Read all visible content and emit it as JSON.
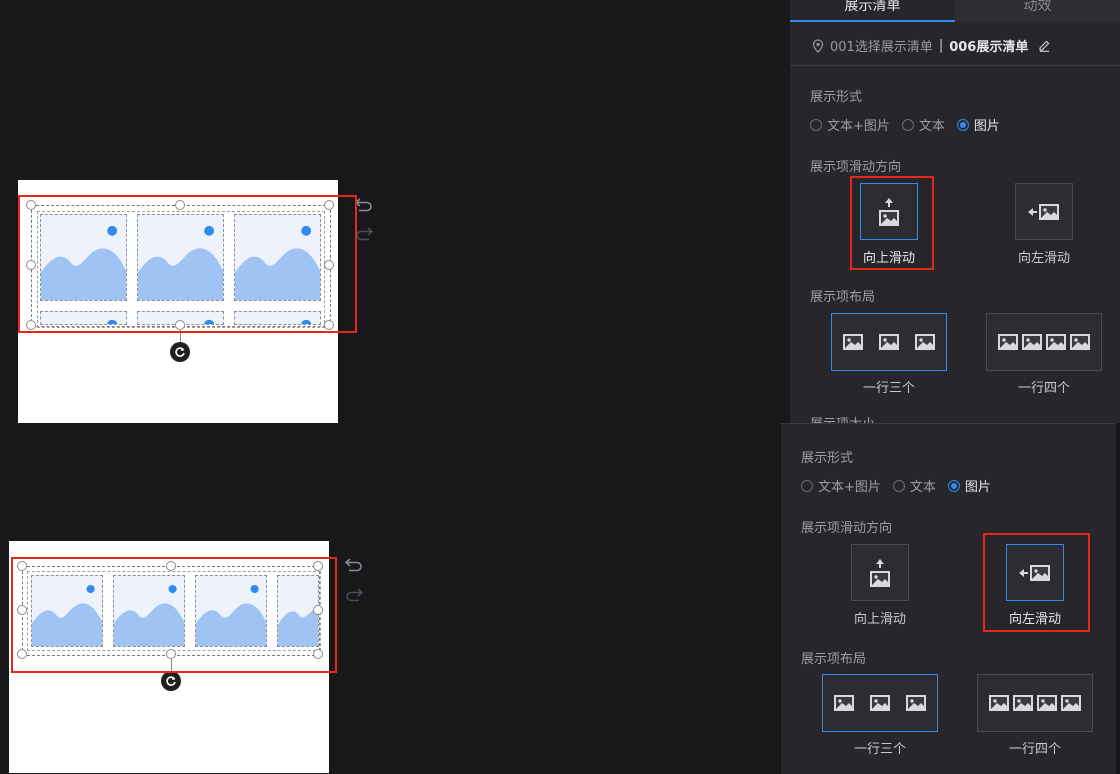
{
  "colors": {
    "background": "#18181b",
    "panel": "#26262b",
    "accent": "#2e8cf0",
    "highlight_red": "#e6281c",
    "tile_fill": "#eef3fb",
    "mountain": "#9fc3f3",
    "sun": "#2e8cf0"
  },
  "top_panel": {
    "tabs": [
      {
        "label": "展示清单",
        "active": true
      },
      {
        "label": "动效",
        "active": false
      }
    ],
    "breadcrumb": {
      "step": "001选择展示清单",
      "separator": "|",
      "current": "006展示清单",
      "edit_icon": "pencil-icon",
      "location_icon": "location-pin-icon"
    },
    "display_form": {
      "title": "展示形式",
      "options": [
        "文本+图片",
        "文本",
        "图片"
      ],
      "selected": "图片"
    },
    "scroll_direction": {
      "title": "展示项滑动方向",
      "options": [
        {
          "label": "向上滑动",
          "icon": "scroll-up-image-icon"
        },
        {
          "label": "向左滑动",
          "icon": "scroll-left-image-icon"
        }
      ],
      "selected": "向上滑动"
    },
    "layout": {
      "title": "展示项布局",
      "options": [
        {
          "label": "一行三个",
          "icon": "three-per-row-icon"
        },
        {
          "label": "一行四个",
          "icon": "four-per-row-icon"
        }
      ],
      "selected": "一行三个"
    },
    "cut_off_title": "展示项大小"
  },
  "bottom_panel": {
    "display_form": {
      "title": "展示形式",
      "options": [
        "文本+图片",
        "文本",
        "图片"
      ],
      "selected": "图片"
    },
    "scroll_direction": {
      "title": "展示项滑动方向",
      "options": [
        {
          "label": "向上滑动",
          "icon": "scroll-up-image-icon"
        },
        {
          "label": "向左滑动",
          "icon": "scroll-left-image-icon"
        }
      ],
      "selected": "向左滑动"
    },
    "layout": {
      "title": "展示项布局",
      "options": [
        {
          "label": "一行三个",
          "icon": "three-per-row-icon"
        },
        {
          "label": "一行四个",
          "icon": "four-per-row-icon"
        }
      ],
      "selected": "一行三个"
    }
  },
  "canvas_top": {
    "layout": "vertical scroll, 3 per row",
    "icons": [
      "undo-icon",
      "redo-icon",
      "rotate-icon"
    ]
  },
  "canvas_bottom": {
    "layout": "horizontal scroll, 4 visible",
    "icons": [
      "undo-icon",
      "redo-icon",
      "rotate-icon"
    ]
  }
}
